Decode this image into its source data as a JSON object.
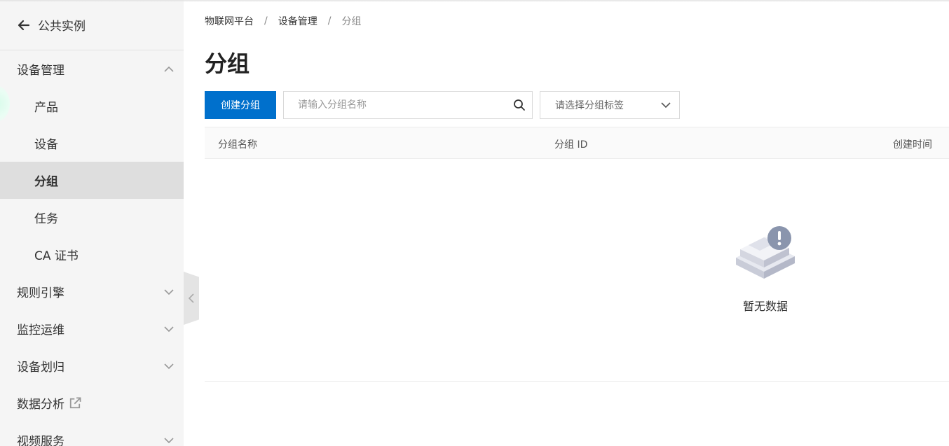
{
  "sidebar": {
    "back_label": "公共实例",
    "groups": {
      "device_mgmt": "设备管理",
      "rules": "规则引擎",
      "ops": "监控运维",
      "assign": "设备划归",
      "analytics": "数据分析",
      "video": "视频服务"
    },
    "items": {
      "product": "产品",
      "device": "设备",
      "group": "分组",
      "task": "任务",
      "ca": "CA 证书"
    },
    "active_item": "分组"
  },
  "breadcrumb": [
    "物联网平台",
    "设备管理",
    "分组"
  ],
  "page": {
    "title": "分组"
  },
  "toolbar": {
    "create_label": "创建分组",
    "search_placeholder": "请输入分组名称",
    "tag_select_placeholder": "请选择分组标签"
  },
  "table": {
    "columns": [
      "分组名称",
      "分组 ID",
      "创建时间"
    ],
    "rows": [],
    "empty_text": "暂无数据"
  },
  "colors": {
    "primary": "#0070cc",
    "sidebar_bg": "#f5f5f5",
    "active_bg": "#dedede"
  }
}
